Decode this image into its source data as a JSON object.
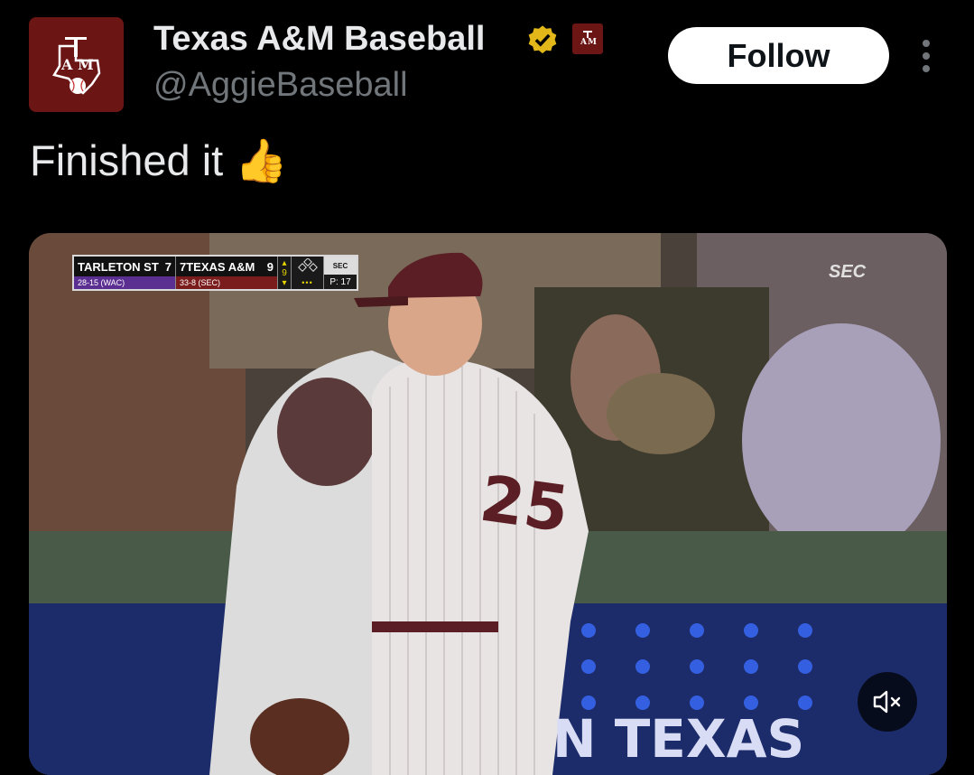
{
  "account": {
    "display_name": "Texas A&M Baseball",
    "handle": "@AggieBaseball",
    "avatar_icon": "texas-atm-baseball-logo",
    "verified_icon": "verified-gold-badge",
    "affiliate_icon": "atm-affiliate-badge",
    "brand_color": "#6b1515",
    "verified_color": "#e2b719"
  },
  "header": {
    "follow_label": "Follow",
    "more_icon": "more-vertical-icon"
  },
  "tweet": {
    "text": "Finished it 👍"
  },
  "media": {
    "type": "video",
    "scorebug": {
      "away_name": "TARLETON ST",
      "away_score": "7",
      "away_record": "28-15 (WAC)",
      "home_name": "7TEXAS A&M",
      "home_score": "9",
      "home_record": "33-8 (SEC)",
      "inning": "9",
      "outs": "•••",
      "pitch_count": "P: 17",
      "network": "SEC"
    },
    "corner_logo": "SEC",
    "jersey_number": "25",
    "banner_text": "N TEXAS",
    "mute_icon": "volume-muted-icon"
  }
}
